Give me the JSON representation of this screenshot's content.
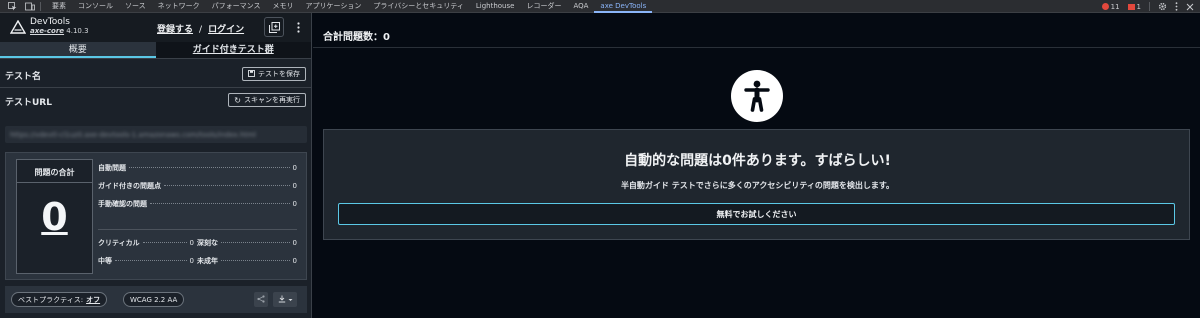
{
  "devtools_tabs": {
    "items": [
      "要素",
      "コンソール",
      "ソース",
      "ネットワーク",
      "パフォーマンス",
      "メモリ",
      "アプリケーション",
      "プライバシーとセキュリティ",
      "Lighthouse",
      "レコーダー",
      "AQA",
      "axe DevTools"
    ],
    "active": "axe DevTools",
    "error_count": "11",
    "issue_count": "1",
    "colors": {
      "active": "#8ab4f8",
      "error": "#e2483d"
    }
  },
  "sidebar": {
    "brand": "DevTools",
    "version_prefix": "axe-core",
    "version": "4.10.3",
    "register_link": "登録する",
    "separator": "/",
    "login_link": "ログイン",
    "tabs": [
      "概要",
      "ガイド付きテスト群"
    ],
    "active_tab": "概要",
    "test_name_label": "テスト名",
    "save_test_button": "テストを保存",
    "test_url_label": "テストURL",
    "rescan_button": "スキャンを再実行",
    "url_value": "https://vdevtl-cl1uz0.axe-devtools-1.amazonaws.com/tools/index.html",
    "summary": {
      "total_label": "問題の合計",
      "total_value": "0",
      "stats_top": [
        {
          "label": "自動問題",
          "value": "0"
        },
        {
          "label": "ガイド付きの問題点",
          "value": "0"
        },
        {
          "label": "手動確認の問題",
          "value": "0"
        }
      ],
      "severity": [
        {
          "label": "クリティカル",
          "value": "0"
        },
        {
          "label": "深刻な",
          "value": "0"
        },
        {
          "label": "中等",
          "value": "0"
        },
        {
          "label": "未成年",
          "value": "0"
        }
      ]
    },
    "best_practices_label": "ベストプラクティス:",
    "best_practices_value": "オフ",
    "wcag_label": "WCAG 2.2 AA",
    "accent_color": "#5bc8e6"
  },
  "main": {
    "total_issues_label": "合計問題数：",
    "total_issues_value": "0",
    "headline": "自動的な問題は0件あります。すばらしい!",
    "description": "半自動ガイド テストでさらに多くのアクセシビリティの問題を検出します。",
    "cta_button": "無料でお試しください"
  }
}
